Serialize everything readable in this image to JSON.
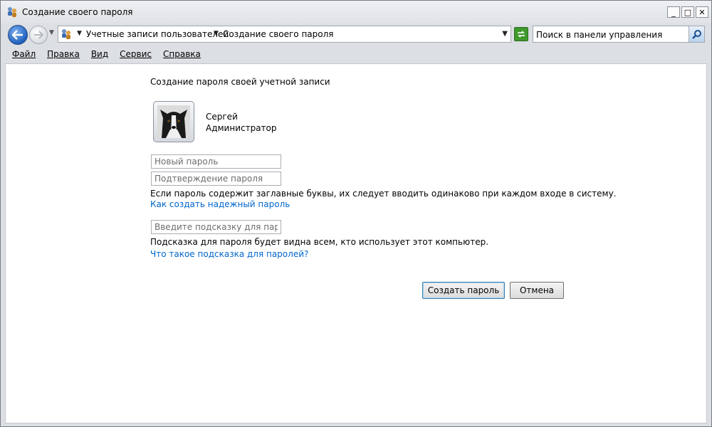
{
  "window": {
    "title": "Создание своего пароля",
    "controls": [
      "_",
      "□",
      "✕"
    ]
  },
  "address_bar": {
    "crumbs": [
      "Учетные записи пользователей",
      "Создание своего пароля"
    ],
    "search_placeholder": "Поиск в панели управления"
  },
  "menu": [
    "Файл",
    "Правка",
    "Вид",
    "Сервис",
    "Справка"
  ],
  "page": {
    "heading": "Создание пароля своей учетной записи",
    "user_name": "Сергей",
    "user_role": "Администратор",
    "new_password_placeholder": "Новый пароль",
    "confirm_password_placeholder": "Подтверждение пароля",
    "case_note": "Если пароль содержит заглавные буквы, их следует вводить одинаково при каждом входе в систему.",
    "strong_password_link": "Как создать надежный пароль",
    "hint_placeholder": "Введите подсказку для пароля",
    "hint_note": "Подсказка для пароля будет видна всем, кто использует этот компьютер.",
    "hint_link": "Что такое подсказка для паролей?",
    "create_button": "Создать пароль",
    "cancel_button": "Отмена"
  },
  "colors": {
    "link": "#0066cc",
    "back_button": "#1f5fbd",
    "refresh_button": "#3e9a2b"
  },
  "icons": [
    "control-panel-users-icon",
    "back-arrow-icon",
    "forward-arrow-icon",
    "refresh-icon",
    "search-icon",
    "user-avatar-dog"
  ]
}
